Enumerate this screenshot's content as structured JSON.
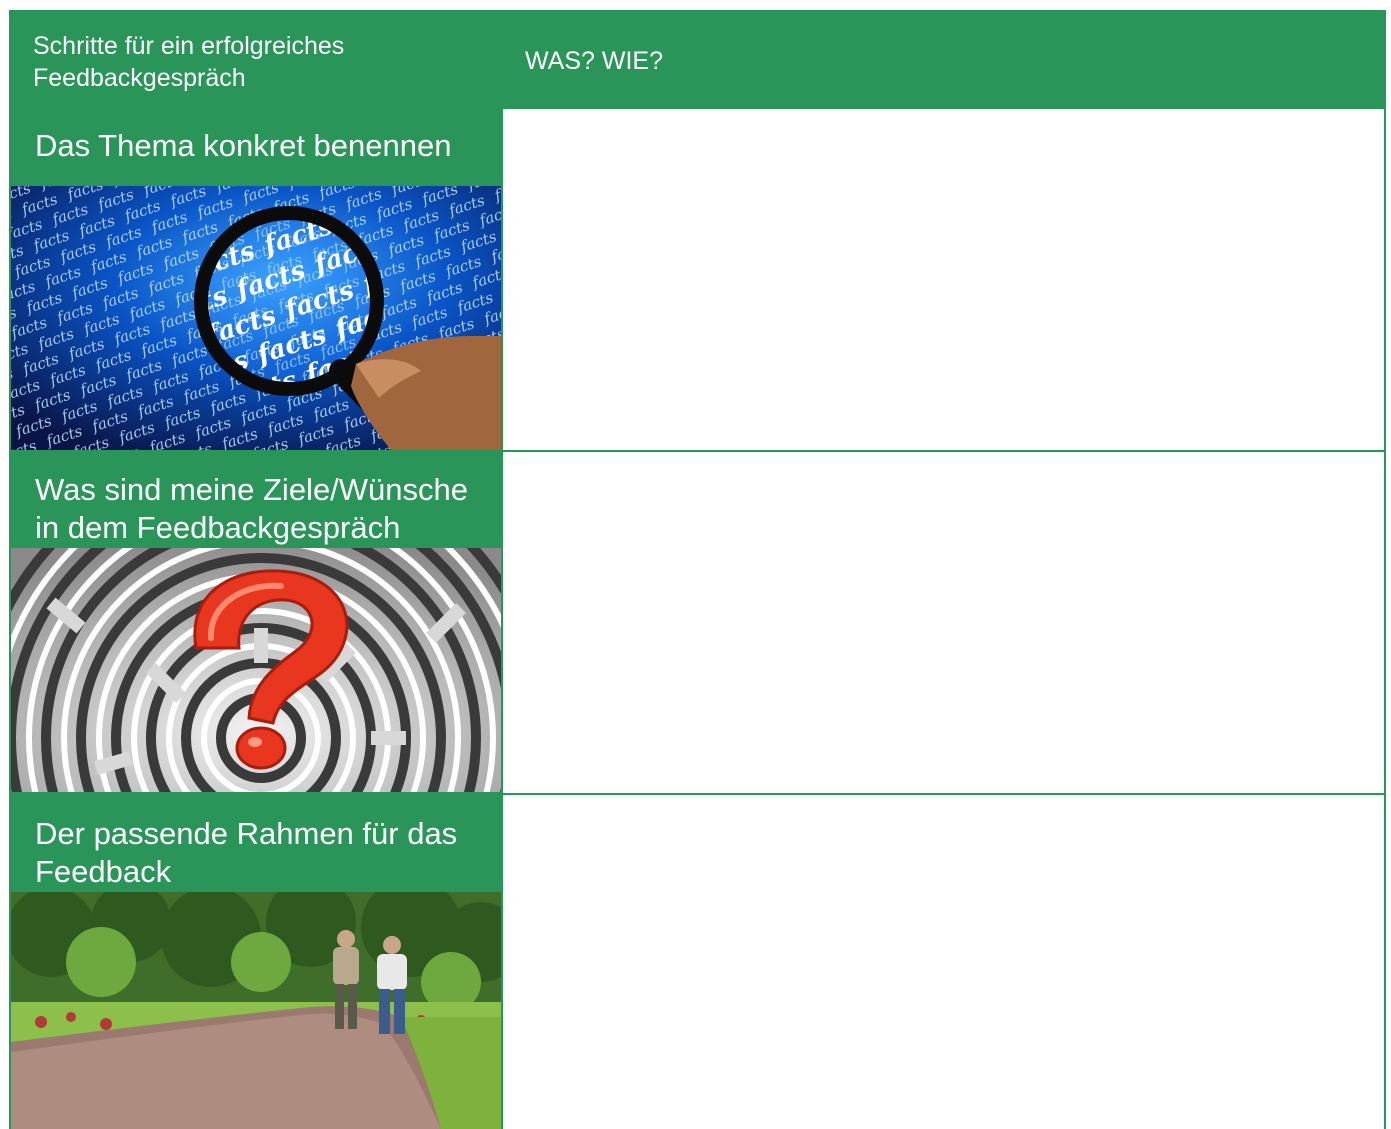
{
  "header": {
    "col1_label": "Schritte für ein erfolgreiches Feedbackgespräch",
    "col2_label": "WAS? WIE?"
  },
  "steps": [
    {
      "title": "Das Thema konkret benennen",
      "image_word": "facts"
    },
    {
      "title": "Was sind meine Ziele/Wünsche in dem Feedbackgespräch"
    },
    {
      "title": "Der passende Rahmen für das Feedback"
    }
  ],
  "colors": {
    "accent_green": "#2a9559",
    "white": "#ffffff"
  }
}
